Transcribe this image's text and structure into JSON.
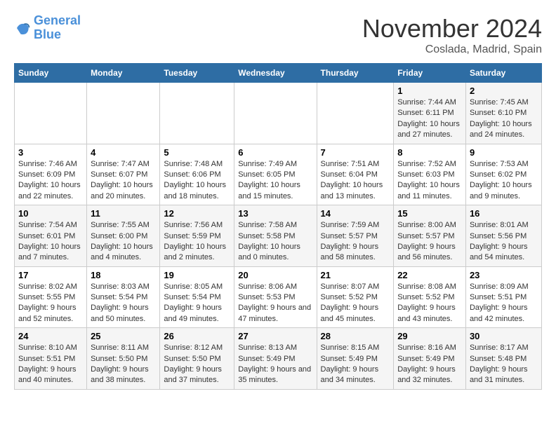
{
  "logo": {
    "text_general": "General",
    "text_blue": "Blue"
  },
  "header": {
    "month": "November 2024",
    "location": "Coslada, Madrid, Spain"
  },
  "weekdays": [
    "Sunday",
    "Monday",
    "Tuesday",
    "Wednesday",
    "Thursday",
    "Friday",
    "Saturday"
  ],
  "weeks": [
    [
      {
        "day": "",
        "info": ""
      },
      {
        "day": "",
        "info": ""
      },
      {
        "day": "",
        "info": ""
      },
      {
        "day": "",
        "info": ""
      },
      {
        "day": "",
        "info": ""
      },
      {
        "day": "1",
        "info": "Sunrise: 7:44 AM\nSunset: 6:11 PM\nDaylight: 10 hours and 27 minutes."
      },
      {
        "day": "2",
        "info": "Sunrise: 7:45 AM\nSunset: 6:10 PM\nDaylight: 10 hours and 24 minutes."
      }
    ],
    [
      {
        "day": "3",
        "info": "Sunrise: 7:46 AM\nSunset: 6:09 PM\nDaylight: 10 hours and 22 minutes."
      },
      {
        "day": "4",
        "info": "Sunrise: 7:47 AM\nSunset: 6:07 PM\nDaylight: 10 hours and 20 minutes."
      },
      {
        "day": "5",
        "info": "Sunrise: 7:48 AM\nSunset: 6:06 PM\nDaylight: 10 hours and 18 minutes."
      },
      {
        "day": "6",
        "info": "Sunrise: 7:49 AM\nSunset: 6:05 PM\nDaylight: 10 hours and 15 minutes."
      },
      {
        "day": "7",
        "info": "Sunrise: 7:51 AM\nSunset: 6:04 PM\nDaylight: 10 hours and 13 minutes."
      },
      {
        "day": "8",
        "info": "Sunrise: 7:52 AM\nSunset: 6:03 PM\nDaylight: 10 hours and 11 minutes."
      },
      {
        "day": "9",
        "info": "Sunrise: 7:53 AM\nSunset: 6:02 PM\nDaylight: 10 hours and 9 minutes."
      }
    ],
    [
      {
        "day": "10",
        "info": "Sunrise: 7:54 AM\nSunset: 6:01 PM\nDaylight: 10 hours and 7 minutes."
      },
      {
        "day": "11",
        "info": "Sunrise: 7:55 AM\nSunset: 6:00 PM\nDaylight: 10 hours and 4 minutes."
      },
      {
        "day": "12",
        "info": "Sunrise: 7:56 AM\nSunset: 5:59 PM\nDaylight: 10 hours and 2 minutes."
      },
      {
        "day": "13",
        "info": "Sunrise: 7:58 AM\nSunset: 5:58 PM\nDaylight: 10 hours and 0 minutes."
      },
      {
        "day": "14",
        "info": "Sunrise: 7:59 AM\nSunset: 5:57 PM\nDaylight: 9 hours and 58 minutes."
      },
      {
        "day": "15",
        "info": "Sunrise: 8:00 AM\nSunset: 5:57 PM\nDaylight: 9 hours and 56 minutes."
      },
      {
        "day": "16",
        "info": "Sunrise: 8:01 AM\nSunset: 5:56 PM\nDaylight: 9 hours and 54 minutes."
      }
    ],
    [
      {
        "day": "17",
        "info": "Sunrise: 8:02 AM\nSunset: 5:55 PM\nDaylight: 9 hours and 52 minutes."
      },
      {
        "day": "18",
        "info": "Sunrise: 8:03 AM\nSunset: 5:54 PM\nDaylight: 9 hours and 50 minutes."
      },
      {
        "day": "19",
        "info": "Sunrise: 8:05 AM\nSunset: 5:54 PM\nDaylight: 9 hours and 49 minutes."
      },
      {
        "day": "20",
        "info": "Sunrise: 8:06 AM\nSunset: 5:53 PM\nDaylight: 9 hours and 47 minutes."
      },
      {
        "day": "21",
        "info": "Sunrise: 8:07 AM\nSunset: 5:52 PM\nDaylight: 9 hours and 45 minutes."
      },
      {
        "day": "22",
        "info": "Sunrise: 8:08 AM\nSunset: 5:52 PM\nDaylight: 9 hours and 43 minutes."
      },
      {
        "day": "23",
        "info": "Sunrise: 8:09 AM\nSunset: 5:51 PM\nDaylight: 9 hours and 42 minutes."
      }
    ],
    [
      {
        "day": "24",
        "info": "Sunrise: 8:10 AM\nSunset: 5:51 PM\nDaylight: 9 hours and 40 minutes."
      },
      {
        "day": "25",
        "info": "Sunrise: 8:11 AM\nSunset: 5:50 PM\nDaylight: 9 hours and 38 minutes."
      },
      {
        "day": "26",
        "info": "Sunrise: 8:12 AM\nSunset: 5:50 PM\nDaylight: 9 hours and 37 minutes."
      },
      {
        "day": "27",
        "info": "Sunrise: 8:13 AM\nSunset: 5:49 PM\nDaylight: 9 hours and 35 minutes."
      },
      {
        "day": "28",
        "info": "Sunrise: 8:15 AM\nSunset: 5:49 PM\nDaylight: 9 hours and 34 minutes."
      },
      {
        "day": "29",
        "info": "Sunrise: 8:16 AM\nSunset: 5:49 PM\nDaylight: 9 hours and 32 minutes."
      },
      {
        "day": "30",
        "info": "Sunrise: 8:17 AM\nSunset: 5:48 PM\nDaylight: 9 hours and 31 minutes."
      }
    ]
  ]
}
